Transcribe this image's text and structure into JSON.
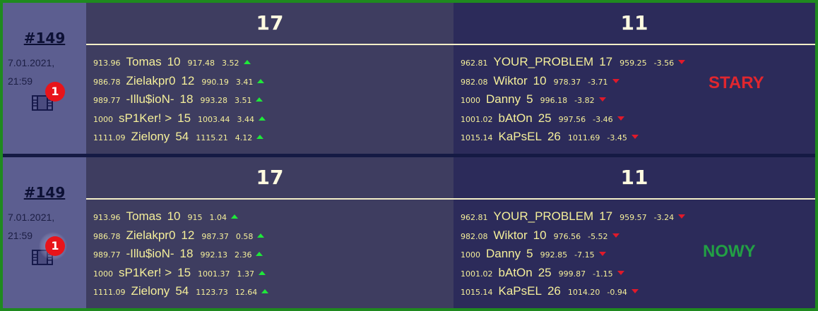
{
  "matches": [
    {
      "id": "#149",
      "date": "7.01.2021,",
      "time": "21:59",
      "badge": "1",
      "icon": "film-icon",
      "label": "STARY",
      "label_color": "#e1262e",
      "team_a": {
        "score": "17",
        "players": [
          {
            "old": "913.96",
            "name": "Tomas",
            "level": "10",
            "new": "917.48",
            "delta": "3.52",
            "dir": "up"
          },
          {
            "old": "986.78",
            "name": "Zielakpr0",
            "level": "12",
            "new": "990.19",
            "delta": "3.41",
            "dir": "up"
          },
          {
            "old": "989.77",
            "name": "-Illu$ioN-",
            "level": "18",
            "new": "993.28",
            "delta": "3.51",
            "dir": "up"
          },
          {
            "old": "1000",
            "name": "sP1Ker! >",
            "level": "15",
            "new": "1003.44",
            "delta": "3.44",
            "dir": "up"
          },
          {
            "old": "1111.09",
            "name": "Zielony",
            "level": "54",
            "new": "1115.21",
            "delta": "4.12",
            "dir": "up"
          }
        ]
      },
      "team_b": {
        "score": "11",
        "players": [
          {
            "old": "962.81",
            "name": "YOUR_PROBLEM",
            "level": "17",
            "new": "959.25",
            "delta": "-3.56",
            "dir": "down"
          },
          {
            "old": "982.08",
            "name": "Wiktor",
            "level": "10",
            "new": "978.37",
            "delta": "-3.71",
            "dir": "down"
          },
          {
            "old": "1000",
            "name": "Danny",
            "level": "5",
            "new": "996.18",
            "delta": "-3.82",
            "dir": "down"
          },
          {
            "old": "1001.02",
            "name": "bAtOn",
            "level": "25",
            "new": "997.56",
            "delta": "-3.46",
            "dir": "down"
          },
          {
            "old": "1015.14",
            "name": "KaPsEL",
            "level": "26",
            "new": "1011.69",
            "delta": "-3.45",
            "dir": "down"
          }
        ]
      }
    },
    {
      "id": "#149",
      "date": "7.01.2021,",
      "time": "21:59",
      "badge": "1",
      "icon": "film-icon",
      "label": "NOWY",
      "label_color": "#22a044",
      "team_a": {
        "score": "17",
        "players": [
          {
            "old": "913.96",
            "name": "Tomas",
            "level": "10",
            "new": "915",
            "delta": "1.04",
            "dir": "up"
          },
          {
            "old": "986.78",
            "name": "Zielakpr0",
            "level": "12",
            "new": "987.37",
            "delta": "0.58",
            "dir": "up"
          },
          {
            "old": "989.77",
            "name": "-Illu$ioN-",
            "level": "18",
            "new": "992.13",
            "delta": "2.36",
            "dir": "up"
          },
          {
            "old": "1000",
            "name": "sP1Ker! >",
            "level": "15",
            "new": "1001.37",
            "delta": "1.37",
            "dir": "up"
          },
          {
            "old": "1111.09",
            "name": "Zielony",
            "level": "54",
            "new": "1123.73",
            "delta": "12.64",
            "dir": "up"
          }
        ]
      },
      "team_b": {
        "score": "11",
        "players": [
          {
            "old": "962.81",
            "name": "YOUR_PROBLEM",
            "level": "17",
            "new": "959.57",
            "delta": "-3.24",
            "dir": "down"
          },
          {
            "old": "982.08",
            "name": "Wiktor",
            "level": "10",
            "new": "976.56",
            "delta": "-5.52",
            "dir": "down"
          },
          {
            "old": "1000",
            "name": "Danny",
            "level": "5",
            "new": "992.85",
            "delta": "-7.15",
            "dir": "down"
          },
          {
            "old": "1001.02",
            "name": "bAtOn",
            "level": "25",
            "new": "999.87",
            "delta": "-1.15",
            "dir": "down"
          },
          {
            "old": "1015.14",
            "name": "KaPsEL",
            "level": "26",
            "new": "1014.20",
            "delta": "-0.94",
            "dir": "down"
          }
        ]
      }
    }
  ]
}
